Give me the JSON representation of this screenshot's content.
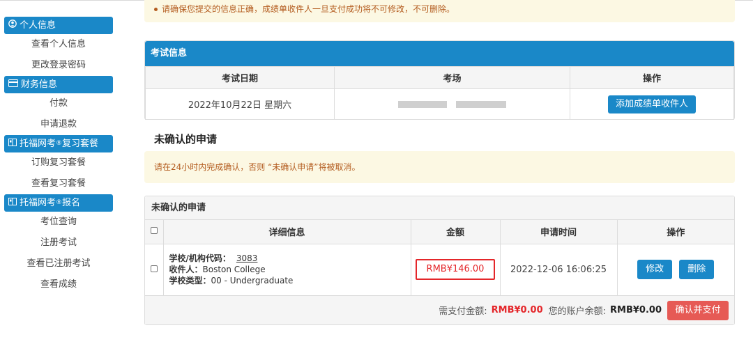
{
  "sidebar": {
    "sections": [
      {
        "title": "个人信息",
        "icon": "user-circle-icon",
        "items": [
          "查看个人信息",
          "更改登录密码"
        ]
      },
      {
        "title": "财务信息",
        "icon": "credit-card-icon",
        "items": [
          "付款",
          "申请退款"
        ]
      },
      {
        "title": "托福网考",
        "sup": "®",
        "suffix": "复习套餐",
        "icon": "book-icon",
        "items": [
          "订购复习套餐",
          "查看复习套餐"
        ]
      },
      {
        "title": "托福网考",
        "sup": "®",
        "suffix": "报名",
        "icon": "book-icon",
        "items": [
          "考位查询",
          "注册考试",
          "查看已注册考试",
          "查看成绩"
        ]
      }
    ]
  },
  "notice_top": "请确保您提交的信息正确，成绩单收件人一旦支付成功将不可修改，不可删除。",
  "exam_panel": {
    "title": "考试信息",
    "headers": [
      "考试日期",
      "考场",
      "操作"
    ],
    "date": "2022年10月22日 星期六",
    "add_recipient_button": "添加成绩单收件人"
  },
  "unconfirmed": {
    "heading": "未确认的申请",
    "notice": "请在24小时内完成确认，否则 “未确认申请”将被取消。",
    "panel_title": "未确认的申请",
    "headers": [
      "详细信息",
      "金额",
      "申请时间",
      "操作"
    ],
    "row": {
      "code_label": "学校/机构代码：",
      "code": "3083",
      "recipient_label": "收件人：",
      "recipient": "Boston College",
      "type_label": "学校类型：",
      "type": "00 - Undergraduate",
      "amount": "RMB¥146.00",
      "time": "2022-12-06 16:06:25",
      "edit_button": "修改",
      "delete_button": "删除"
    },
    "footer": {
      "need_pay_label": "需支付金额:",
      "need_pay": "RMB¥0.00",
      "balance_label": "您的账户余额:",
      "balance": "RMB¥0.00",
      "confirm_button": "确认并支付"
    }
  },
  "colors": {
    "primary": "#1a88c8",
    "alert_bg": "#fcf8e3",
    "alert_text": "#b35b1e",
    "danger": "#e4262a",
    "danger_button": "#e65a55"
  }
}
